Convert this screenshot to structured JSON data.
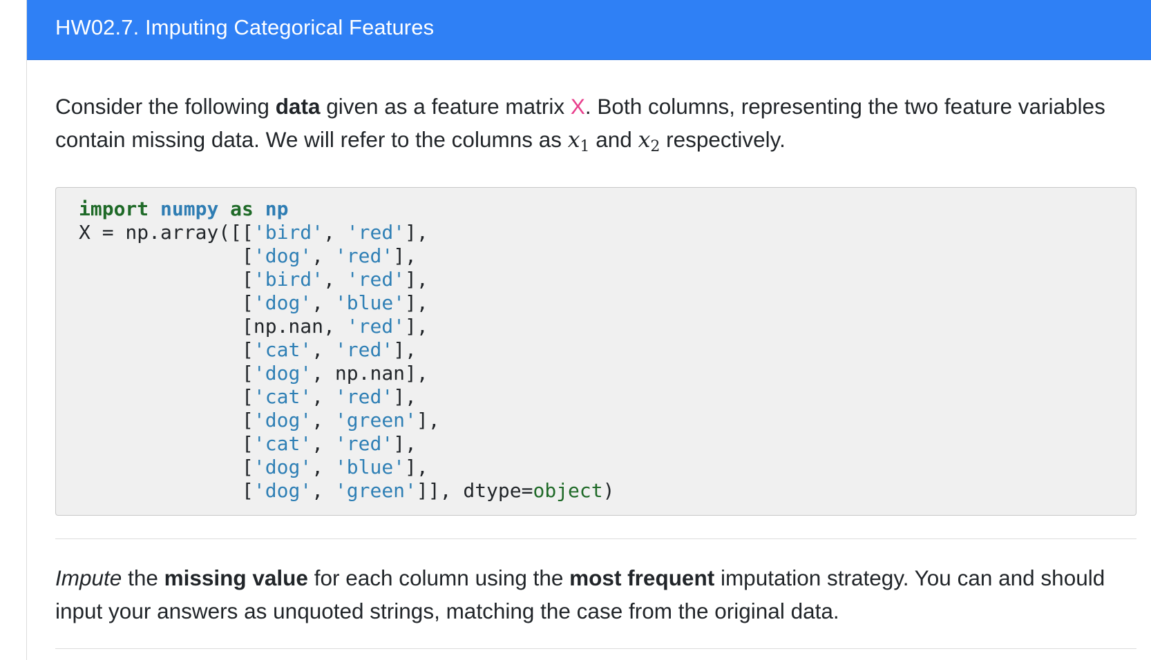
{
  "header": {
    "title": "HW02.7. Imputing Categorical Features"
  },
  "intro": {
    "t1": "Consider the following ",
    "t2": "data",
    "t3": " given as a feature matrix ",
    "t4": "X",
    "t5": ". Both columns, representing the two feature variables contain missing data. We will refer to the columns as ",
    "m1": "x",
    "s1": "1",
    "t6": " and ",
    "m2": "x",
    "s2": "2",
    "t7": " respectively."
  },
  "code": {
    "line0": {
      "kw1": "import",
      "sp1": " ",
      "mod1": "numpy",
      "sp2": " ",
      "kw2": "as",
      "sp3": " ",
      "mod2": "np"
    },
    "lines": [
      {
        "pre": "X = np.array([[",
        "a": "'bird'",
        "mid": ", ",
        "b": "'red'",
        "post": "],"
      },
      {
        "pre": "              [",
        "a": "'dog'",
        "mid": ", ",
        "b": "'red'",
        "post": "],"
      },
      {
        "pre": "              [",
        "a": "'bird'",
        "mid": ", ",
        "b": "'red'",
        "post": "],"
      },
      {
        "pre": "              [",
        "a": "'dog'",
        "mid": ", ",
        "b": "'blue'",
        "post": "],"
      },
      {
        "pre": "              [np.nan, ",
        "a": "",
        "mid": "",
        "b": "'red'",
        "post": "],"
      },
      {
        "pre": "              [",
        "a": "'cat'",
        "mid": ", ",
        "b": "'red'",
        "post": "],"
      },
      {
        "pre": "              [",
        "a": "'dog'",
        "mid": ", np.nan],",
        "b": "",
        "post": ""
      },
      {
        "pre": "              [",
        "a": "'cat'",
        "mid": ", ",
        "b": "'red'",
        "post": "],"
      },
      {
        "pre": "              [",
        "a": "'dog'",
        "mid": ", ",
        "b": "'green'",
        "post": "],"
      },
      {
        "pre": "              [",
        "a": "'cat'",
        "mid": ", ",
        "b": "'red'",
        "post": "],"
      },
      {
        "pre": "              [",
        "a": "'dog'",
        "mid": ", ",
        "b": "'blue'",
        "post": "],"
      },
      {
        "pre": "              [",
        "a": "'dog'",
        "mid": ", ",
        "b": "'green'",
        "post": "]], dtype="
      }
    ],
    "dtype_value": "object",
    "close": ")"
  },
  "task": {
    "t1": "Impute",
    "t2": " the ",
    "t3": "missing value",
    "t4": " for each column using the ",
    "t5": "most frequent",
    "t6": " imputation strategy. You can and should input your answers as unquoted strings, matching the case from the original data."
  }
}
